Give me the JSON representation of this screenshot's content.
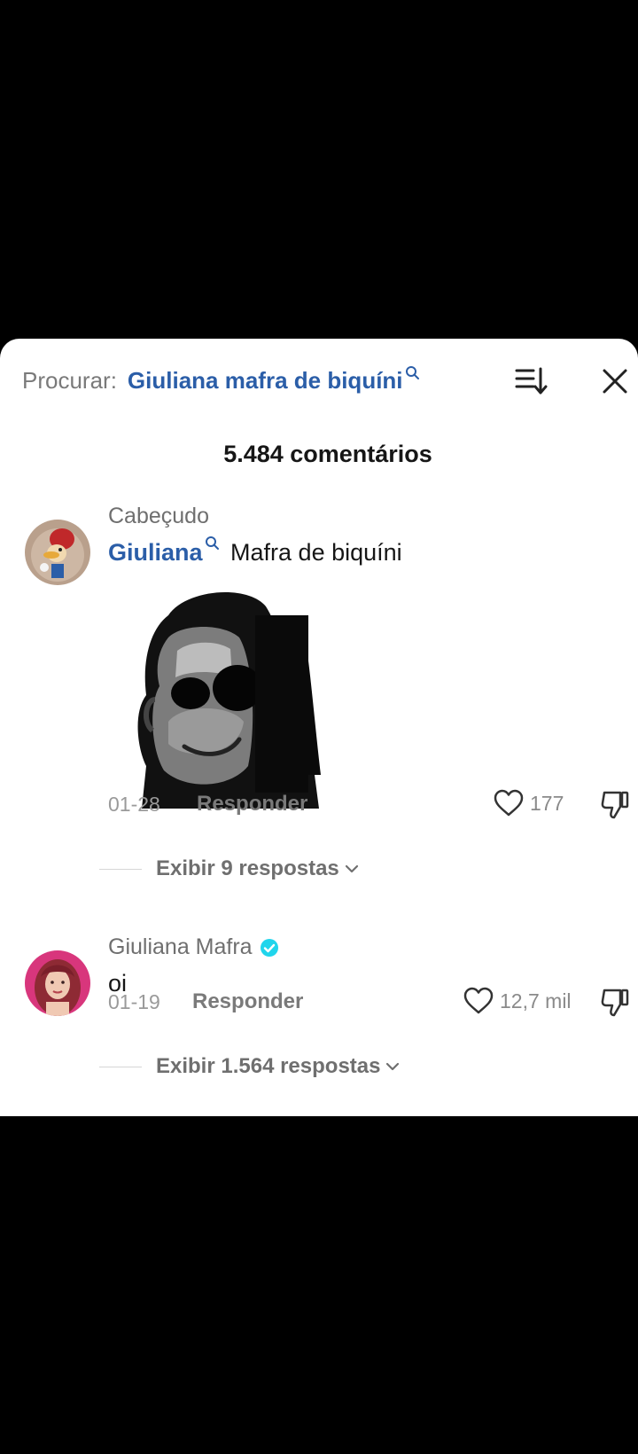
{
  "search": {
    "prefix": "Procurar:",
    "term": "Giuliana mafra de biquíni"
  },
  "icons": {
    "sort": "sort-descending-icon",
    "close": "close-icon",
    "search": "search-icon",
    "like": "heart-icon",
    "dislike": "thumbs-down-icon",
    "verified": "verified-badge-icon",
    "chevron": "chevron-down-icon"
  },
  "colors": {
    "accent": "#2b5ea8",
    "verified": "#20d5ec",
    "sheet": "#ffffff",
    "background": "#000000"
  },
  "comments_count": "5.484 comentários",
  "comments": [
    {
      "username": "Cabeçudo",
      "mention": "Giuliana",
      "text": " Mafra de biquíni",
      "date": "01-28",
      "reply_label": "Responder",
      "likes": "177",
      "replies_label": "Exibir 9 respostas"
    },
    {
      "username": "Giuliana Mafra",
      "verified": true,
      "text": "oi",
      "date": "01-19",
      "reply_label": "Responder",
      "likes": "12,7 mil",
      "replies_label": "Exibir 1.564 respostas"
    }
  ]
}
